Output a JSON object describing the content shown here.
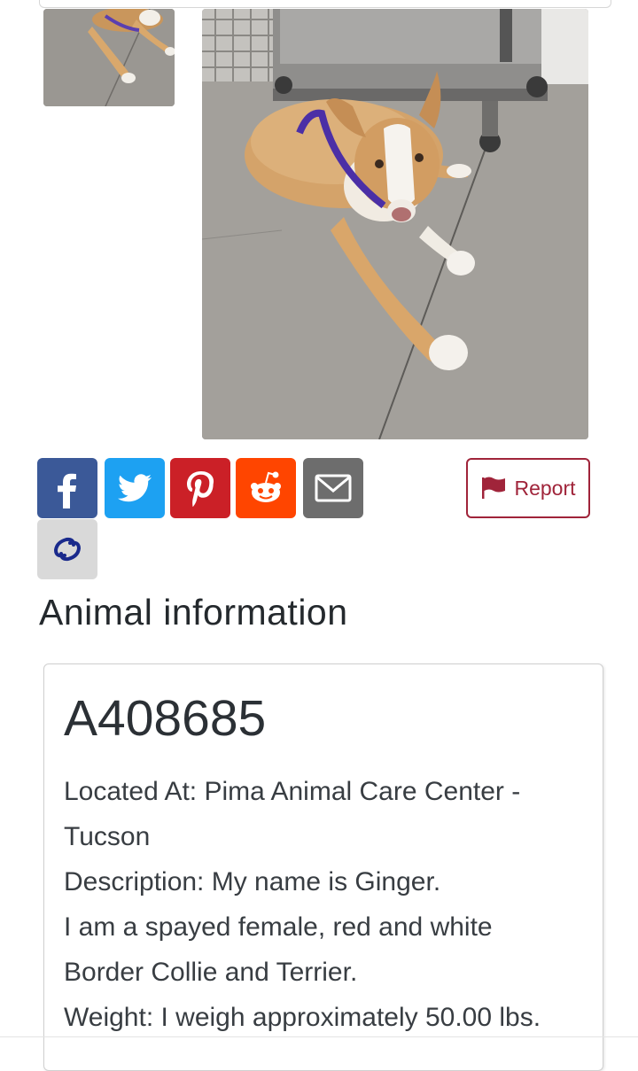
{
  "share": {
    "buttons": [
      {
        "name": "facebook",
        "icon": "facebook-icon",
        "color": "#3b5998"
      },
      {
        "name": "twitter",
        "icon": "twitter-icon",
        "color": "#1da1f2"
      },
      {
        "name": "pinterest",
        "icon": "pinterest-icon",
        "color": "#cb2027"
      },
      {
        "name": "reddit",
        "icon": "reddit-icon",
        "color": "#ff4500"
      },
      {
        "name": "email",
        "icon": "envelope-icon",
        "color": "#6d6d6d"
      },
      {
        "name": "copy-link",
        "icon": "link-icon",
        "color": "#d9d9d9"
      }
    ]
  },
  "report": {
    "label": "Report",
    "icon": "flag-icon",
    "color": "#a0243a"
  },
  "section_title": "Animal information",
  "animal": {
    "id": "A408685",
    "lines": [
      "Located At: Pima Animal Care Center -",
      "Tucson",
      "Description: My name is Ginger.",
      "I am a spayed female, red and white",
      "Border Collie and Terrier.",
      "Weight: I weigh approximately 50.00 lbs."
    ]
  }
}
